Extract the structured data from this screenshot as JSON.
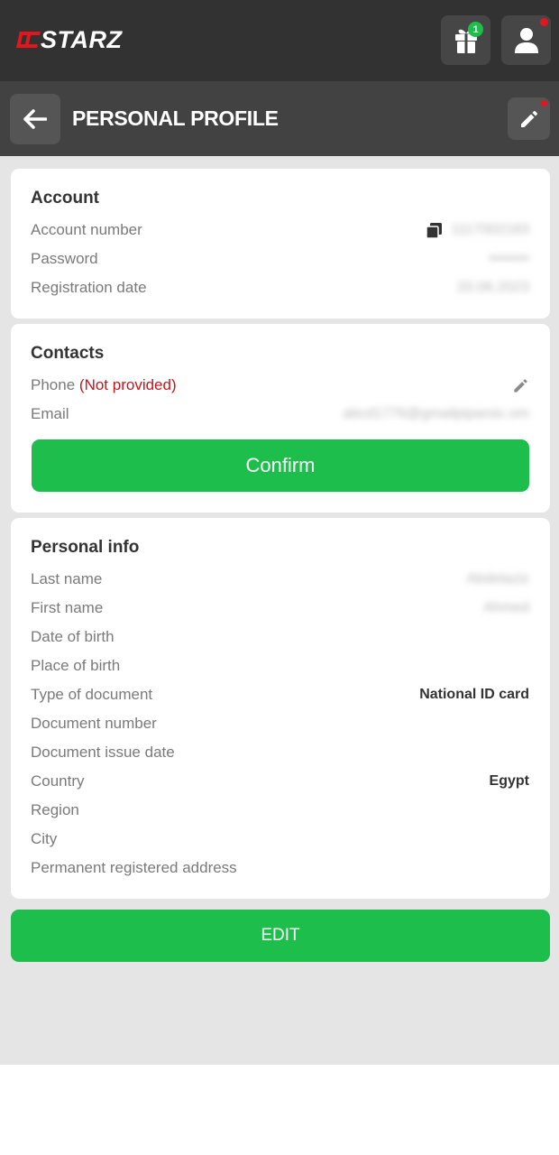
{
  "app": {
    "brand": "STARZ",
    "gift_badge_count": "1"
  },
  "header": {
    "title": "PERSONAL PROFILE"
  },
  "account": {
    "title": "Account",
    "rows": [
      {
        "label": "Account number",
        "value": "1117002183"
      },
      {
        "label": "Password",
        "value": "••••••••"
      },
      {
        "label": "Registration date",
        "value": "20.06.2023"
      }
    ]
  },
  "contacts": {
    "title": "Contacts",
    "phone_label": "Phone",
    "phone_status": "(Not provided)",
    "email_label": "Email",
    "email_value": "abcd1776@gmailpiparsic.om",
    "confirm_label": "Confirm"
  },
  "personal": {
    "title": "Personal info",
    "rows": [
      {
        "label": "Last name",
        "value": "Abdelaziz",
        "blurred": true
      },
      {
        "label": "First name",
        "value": "Ahmed",
        "blurred": true
      },
      {
        "label": "Date of birth",
        "value": ""
      },
      {
        "label": "Place of birth",
        "value": ""
      },
      {
        "label": "Type of document",
        "value": "National ID card"
      },
      {
        "label": "Document number",
        "value": ""
      },
      {
        "label": "Document issue date",
        "value": ""
      },
      {
        "label": "Country",
        "value": "Egypt"
      },
      {
        "label": "Region",
        "value": ""
      },
      {
        "label": "City",
        "value": ""
      },
      {
        "label": "Permanent registered address",
        "value": ""
      }
    ]
  },
  "actions": {
    "edit_label": "EDIT"
  },
  "colors": {
    "accent_green": "#1dbe4b",
    "alert_red": "#e3161d",
    "topbar": "#323232",
    "header": "#424242"
  }
}
